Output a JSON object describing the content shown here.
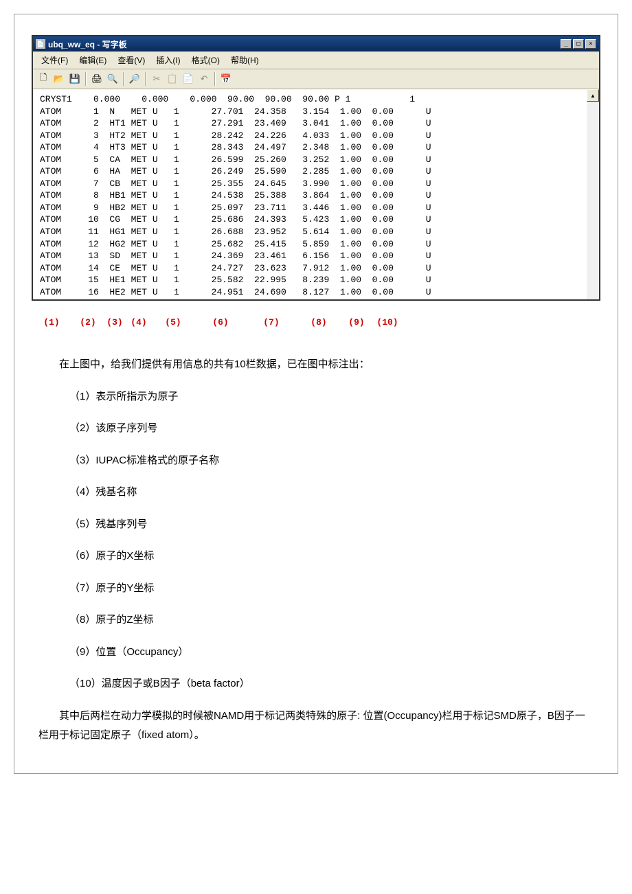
{
  "window": {
    "title": "ubq_ww_eq - 写字板",
    "minimize": "_",
    "maximize": "□",
    "close": "×"
  },
  "menu": {
    "file": "文件(F)",
    "edit": "编辑(E)",
    "view": "查看(V)",
    "insert": "插入(I)",
    "format": "格式(O)",
    "help": "帮助(H)"
  },
  "content_line1": "CRYST1    0.000    0.000    0.000  90.00  90.00  90.00 P 1           1",
  "atoms": [
    {
      "rec": "ATOM",
      "n": "1",
      "name": "N  ",
      "res": "MET",
      "ch": "U",
      "seq": "1",
      "x": "27.701",
      "y": "24.358",
      "z": "3.154",
      "occ": "1.00",
      "bf": "0.00",
      "el": "U"
    },
    {
      "rec": "ATOM",
      "n": "2",
      "name": "HT1",
      "res": "MET",
      "ch": "U",
      "seq": "1",
      "x": "27.291",
      "y": "23.409",
      "z": "3.041",
      "occ": "1.00",
      "bf": "0.00",
      "el": "U"
    },
    {
      "rec": "ATOM",
      "n": "3",
      "name": "HT2",
      "res": "MET",
      "ch": "U",
      "seq": "1",
      "x": "28.242",
      "y": "24.226",
      "z": "4.033",
      "occ": "1.00",
      "bf": "0.00",
      "el": "U"
    },
    {
      "rec": "ATOM",
      "n": "4",
      "name": "HT3",
      "res": "MET",
      "ch": "U",
      "seq": "1",
      "x": "28.343",
      "y": "24.497",
      "z": "2.348",
      "occ": "1.00",
      "bf": "0.00",
      "el": "U"
    },
    {
      "rec": "ATOM",
      "n": "5",
      "name": "CA ",
      "res": "MET",
      "ch": "U",
      "seq": "1",
      "x": "26.599",
      "y": "25.260",
      "z": "3.252",
      "occ": "1.00",
      "bf": "0.00",
      "el": "U"
    },
    {
      "rec": "ATOM",
      "n": "6",
      "name": "HA ",
      "res": "MET",
      "ch": "U",
      "seq": "1",
      "x": "26.249",
      "y": "25.590",
      "z": "2.285",
      "occ": "1.00",
      "bf": "0.00",
      "el": "U"
    },
    {
      "rec": "ATOM",
      "n": "7",
      "name": "CB ",
      "res": "MET",
      "ch": "U",
      "seq": "1",
      "x": "25.355",
      "y": "24.645",
      "z": "3.990",
      "occ": "1.00",
      "bf": "0.00",
      "el": "U"
    },
    {
      "rec": "ATOM",
      "n": "8",
      "name": "HB1",
      "res": "MET",
      "ch": "U",
      "seq": "1",
      "x": "24.538",
      "y": "25.388",
      "z": "3.864",
      "occ": "1.00",
      "bf": "0.00",
      "el": "U"
    },
    {
      "rec": "ATOM",
      "n": "9",
      "name": "HB2",
      "res": "MET",
      "ch": "U",
      "seq": "1",
      "x": "25.097",
      "y": "23.711",
      "z": "3.446",
      "occ": "1.00",
      "bf": "0.00",
      "el": "U"
    },
    {
      "rec": "ATOM",
      "n": "10",
      "name": "CG ",
      "res": "MET",
      "ch": "U",
      "seq": "1",
      "x": "25.686",
      "y": "24.393",
      "z": "5.423",
      "occ": "1.00",
      "bf": "0.00",
      "el": "U"
    },
    {
      "rec": "ATOM",
      "n": "11",
      "name": "HG1",
      "res": "MET",
      "ch": "U",
      "seq": "1",
      "x": "26.688",
      "y": "23.952",
      "z": "5.614",
      "occ": "1.00",
      "bf": "0.00",
      "el": "U"
    },
    {
      "rec": "ATOM",
      "n": "12",
      "name": "HG2",
      "res": "MET",
      "ch": "U",
      "seq": "1",
      "x": "25.682",
      "y": "25.415",
      "z": "5.859",
      "occ": "1.00",
      "bf": "0.00",
      "el": "U"
    },
    {
      "rec": "ATOM",
      "n": "13",
      "name": "SD ",
      "res": "MET",
      "ch": "U",
      "seq": "1",
      "x": "24.369",
      "y": "23.461",
      "z": "6.156",
      "occ": "1.00",
      "bf": "0.00",
      "el": "U"
    },
    {
      "rec": "ATOM",
      "n": "14",
      "name": "CE ",
      "res": "MET",
      "ch": "U",
      "seq": "1",
      "x": "24.727",
      "y": "23.623",
      "z": "7.912",
      "occ": "1.00",
      "bf": "0.00",
      "el": "U"
    },
    {
      "rec": "ATOM",
      "n": "15",
      "name": "HE1",
      "res": "MET",
      "ch": "U",
      "seq": "1",
      "x": "25.582",
      "y": "22.995",
      "z": "8.239",
      "occ": "1.00",
      "bf": "0.00",
      "el": "U"
    },
    {
      "rec": "ATOM",
      "n": "16",
      "name": "HE2",
      "res": "MET",
      "ch": "U",
      "seq": "1",
      "x": "24.951",
      "y": "24.690",
      "z": "8.127",
      "occ": "1.00",
      "bf": "0.00",
      "el": "U"
    }
  ],
  "markers": [
    "(1)",
    "(2)",
    "(3)",
    "(4)",
    "(5)",
    "(6)",
    "(7)",
    "(8)",
    "(9)",
    "(10)"
  ],
  "explain": {
    "intro": "在上图中，给我们提供有用信息的共有10栏数据，已在图中标注出：",
    "items": [
      "（1）表示所指示为原子",
      "（2）该原子序列号",
      "（3）IUPAC标准格式的原子名称",
      "（4）残基名称",
      "（5）残基序列号",
      "（6）原子的X坐标",
      "（7）原子的Y坐标",
      "（8）原子的Z坐标",
      "（9）位置（Occupancy）",
      "（10）温度因子或B因子（beta factor）"
    ],
    "outro": "其中后两栏在动力学模拟的时候被NAMD用于标记两类特殊的原子: 位置(Occupancy)栏用于标记SMD原子，B因子一栏用于标记固定原子（fixed atom）。"
  }
}
